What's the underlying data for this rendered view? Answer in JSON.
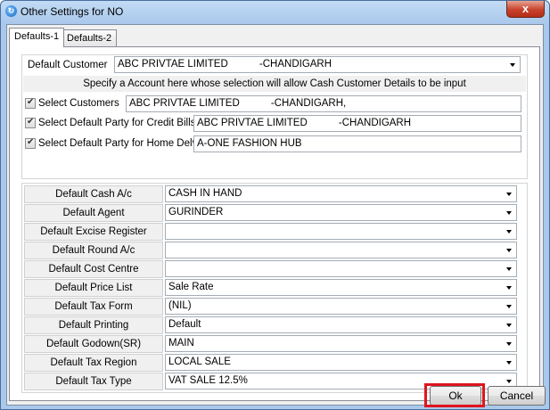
{
  "window": {
    "title": "Other Settings for NO",
    "close_label": "x"
  },
  "tabs": [
    "Defaults-1",
    "Defaults-2"
  ],
  "default_customer": {
    "label": "Default Customer",
    "value": "ABC PRIVTAE LIMITED           -CHANDIGARH"
  },
  "info_text": "Specify a Account here whose selection will allow Cash Customer Details to be input",
  "checks": [
    {
      "label": "Select Customers",
      "value": "ABC PRIVTAE LIMITED           -CHANDIGARH,"
    },
    {
      "label": "Select Default Party for Credit Bills",
      "value": "ABC PRIVTAE LIMITED           -CHANDIGARH"
    },
    {
      "label": "Select Default Party for Home Delv",
      "value": "A-ONE FASHION HUB"
    }
  ],
  "settings": [
    {
      "label": "Default Cash A/c",
      "value": "CASH IN HAND"
    },
    {
      "label": "Default Agent",
      "value": "GURINDER"
    },
    {
      "label": "Default Excise Register",
      "value": ""
    },
    {
      "label": "Default Round A/c",
      "value": ""
    },
    {
      "label": "Default Cost Centre",
      "value": ""
    },
    {
      "label": "Default Price List",
      "value": "Sale Rate"
    },
    {
      "label": "Default Tax Form",
      "value": "(NIL)"
    },
    {
      "label": "Default Printing",
      "value": "Default"
    },
    {
      "label": "Default Godown(SR)",
      "value": "MAIN"
    },
    {
      "label": "Default Tax Region",
      "value": "LOCAL SALE"
    },
    {
      "label": "Default Tax Type",
      "value": "VAT SALE 12.5%"
    }
  ],
  "buttons": {
    "ok": "Ok",
    "cancel": "Cancel"
  },
  "colors": {
    "highlight": "#e0141e",
    "title_bar": "#a9c8eb"
  }
}
